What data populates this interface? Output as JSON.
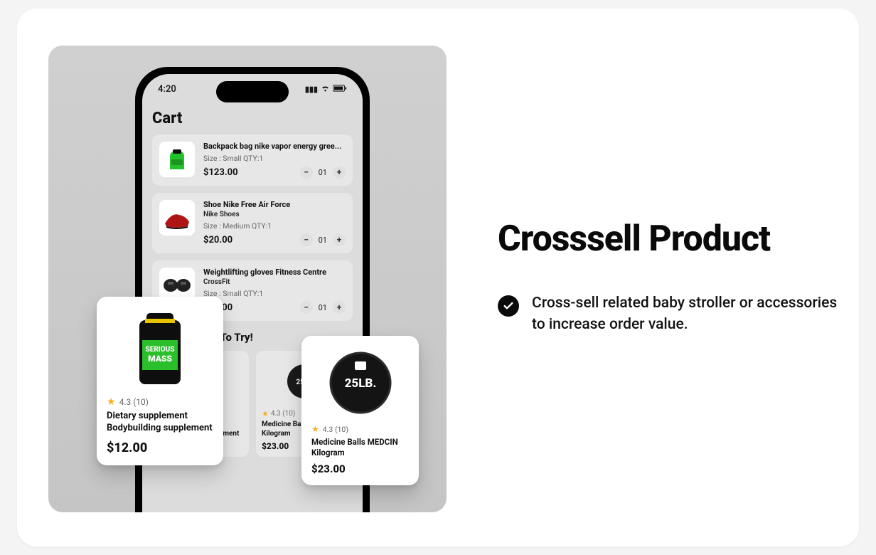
{
  "marketing": {
    "heading": "Crosssell Product",
    "bullet": "Cross-sell related baby stroller or accessories to increase order value."
  },
  "phone": {
    "time": "4:20",
    "title": "Cart",
    "more_label": "More Product To Try!",
    "cart": [
      {
        "title": "Backpack bag nike vapor energy gree...",
        "subtitle": "",
        "meta": "Size : Small   QTY:1",
        "price": "$123.00",
        "qty": "01"
      },
      {
        "title": "Shoe Nike Free Air Force",
        "subtitle": "Nike Shoes",
        "meta": "Size : Medium   QTY:1",
        "price": "$20.00",
        "qty": "01"
      },
      {
        "title": "Weightlifting gloves Fitness Centre",
        "subtitle": "CrossFit",
        "meta": "Size : Small   QTY:1",
        "price": "$10.00",
        "qty": "01"
      }
    ],
    "suggestions": [
      {
        "rating_text": "4.3 (10)",
        "name_line1": "Dietary supplement",
        "name_line2": "Bodybuilding supplement",
        "price": "$12.00"
      },
      {
        "rating_text": "4.3 (10)",
        "name_line1": "Medicine Balls MEDCIN",
        "name_line2": "Kilogram",
        "price": "$23.00"
      }
    ]
  },
  "float": {
    "a": {
      "rating_text": "4.3 (10)",
      "line1": "Dietary supplement",
      "line2": "Bodybuilding supplement",
      "price": "$12.00"
    },
    "b": {
      "rating_text": "4.3 (10)",
      "line1": "Medicine Balls MEDCIN",
      "line2": "Kilogram",
      "price": "$23.00"
    }
  }
}
